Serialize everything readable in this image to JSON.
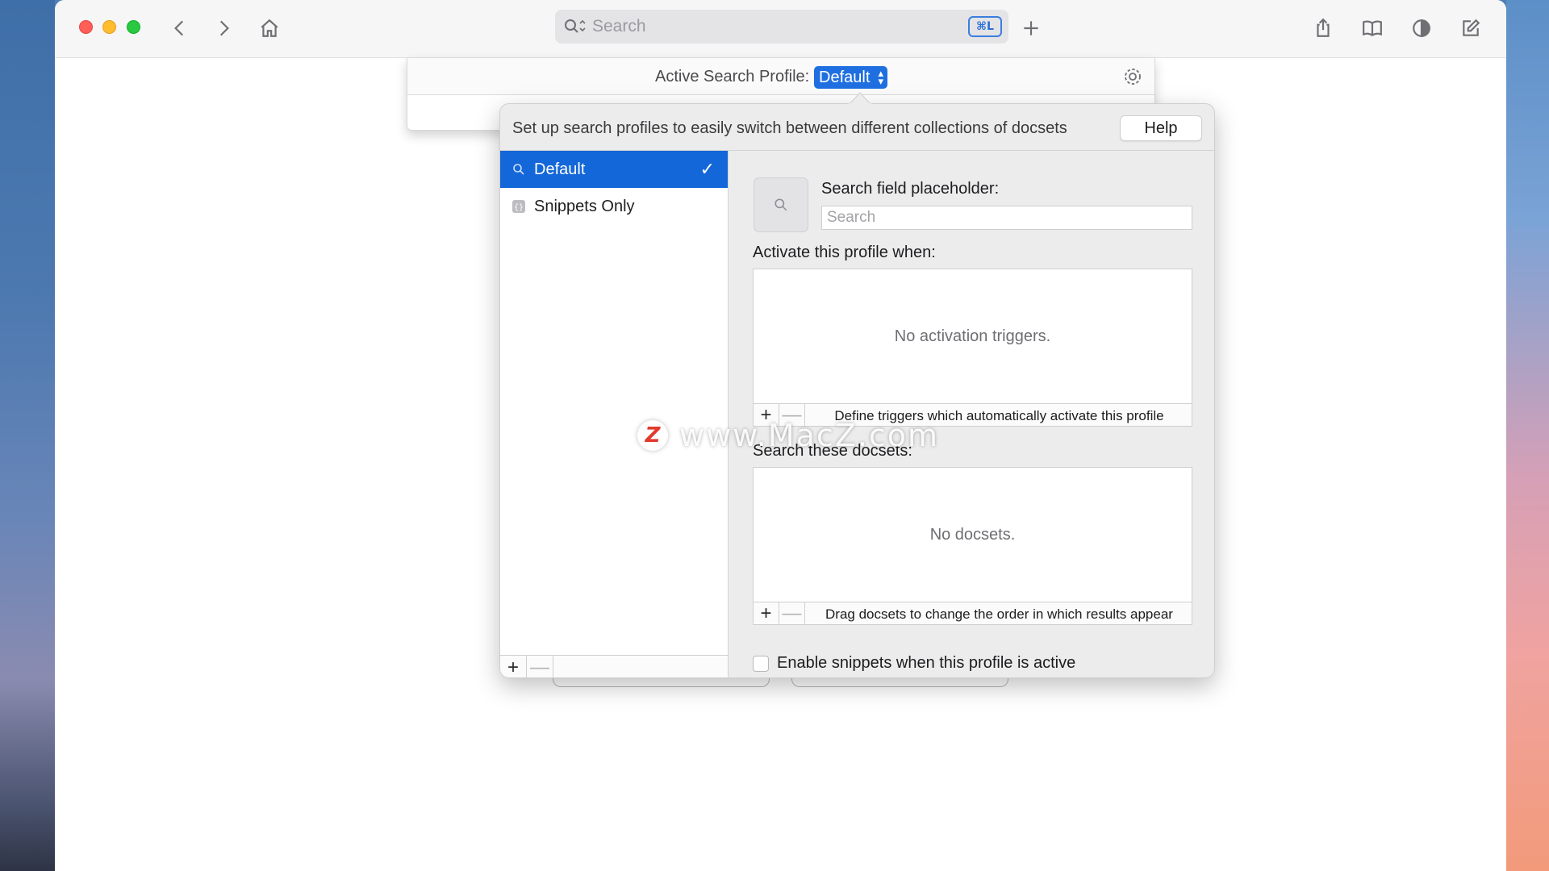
{
  "browser": {
    "search_placeholder": "Search",
    "shortcut_badge": "⌘L",
    "new_tab_label": "+"
  },
  "sheet": {
    "active_profile_label": "Active Search Profile:",
    "active_profile_value": "Default"
  },
  "popover": {
    "description": "Set up search profiles to easily switch between different collections of docsets",
    "help_label": "Help",
    "profiles": [
      {
        "label": "Default",
        "selected": true,
        "icon": "magnifier-icon"
      },
      {
        "label": "Snippets Only",
        "selected": false,
        "icon": "snippet-icon"
      }
    ],
    "placeholder_label": "Search field placeholder:",
    "placeholder_input": "Search",
    "triggers_label": "Activate this profile when:",
    "triggers_empty": "No activation triggers.",
    "triggers_hint": "Define triggers which automatically activate this profile",
    "docsets_label": "Search these docsets:",
    "docsets_empty": "No docsets.",
    "docsets_hint": "Drag docsets to change the order in which results appear",
    "snippets_checkbox_label": "Enable snippets when this profile is active",
    "snippets_enabled": false
  },
  "watermark": {
    "logo_letter": "Z",
    "text": "www.MacZ.com"
  },
  "colors": {
    "accent": "#1467d8",
    "close": "#ff5f57",
    "minimize": "#febc2e",
    "zoom": "#28c840"
  }
}
